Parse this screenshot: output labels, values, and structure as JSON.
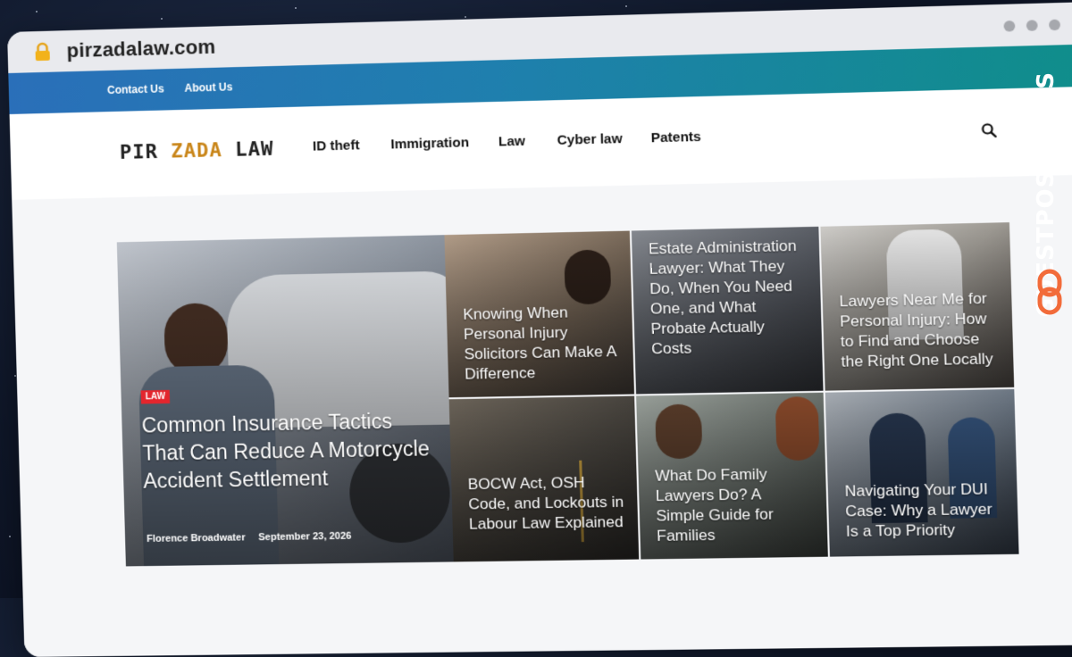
{
  "browser": {
    "url": "pirzadalaw.com"
  },
  "topbar": {
    "links": [
      "Contact Us",
      "About Us"
    ]
  },
  "header": {
    "logo_part1": "PIR",
    "logo_part2": "ZADA",
    "logo_part3": "LAW",
    "nav": [
      "ID theft",
      "Immigration",
      "Law",
      "Cyber law",
      "Patents"
    ]
  },
  "hero": {
    "badge": "LAW",
    "title": "Common Insurance Tactics That Can Reduce A Motorcycle Accident Settlement",
    "author": "Florence Broadwater",
    "date": "September 23, 2026"
  },
  "grid": [
    {
      "title": "Knowing When Personal Injury Solicitors Can Make A Difference"
    },
    {
      "title": "Estate Administration Lawyer: What They Do, When You Need One, and What Probate Actually Costs"
    },
    {
      "title": "Lawyers Near Me for Personal Injury: How to Find and Choose the Right One Locally"
    },
    {
      "title": "BOCW Act, OSH Code, and Lockouts in Labour Law Explained"
    },
    {
      "title": "What Do Family Lawyers Do? A Simple Guide for Families"
    },
    {
      "title": "Navigating Your DUI Case: Why a Lawyer Is a Top Priority"
    }
  ],
  "watermark": {
    "text": "GUESTPOSTLINKS"
  },
  "colors": {
    "accent": "#c9861a",
    "badge": "#e3252d",
    "topbar_start": "#2a6fb9",
    "topbar_end": "#0f8e8a",
    "watermark_icon": "#f26b3a"
  }
}
